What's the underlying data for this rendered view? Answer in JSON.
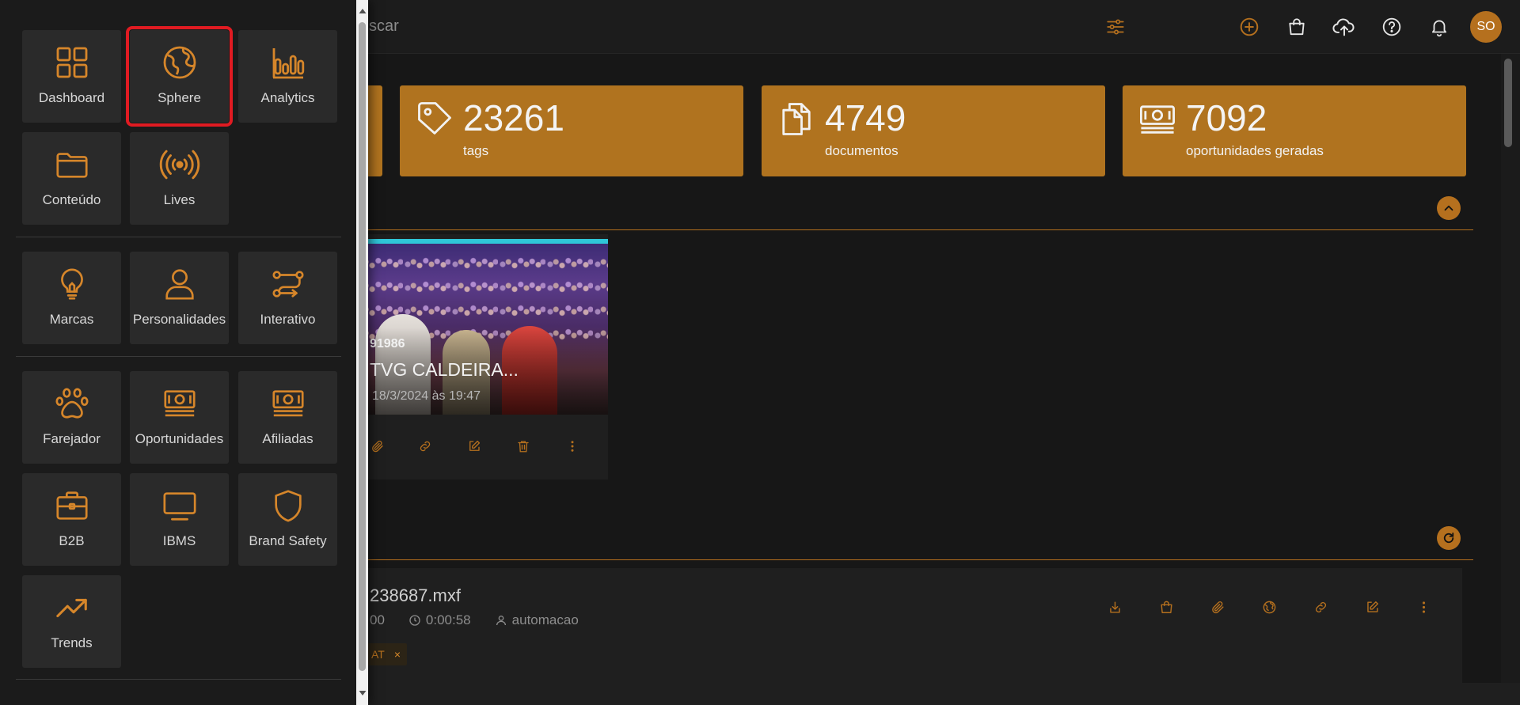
{
  "colors": {
    "accent": "#b5701e",
    "card": "#b0731f",
    "selected_outline": "#e01b22",
    "background": "#171717"
  },
  "header": {
    "search_text": "scar",
    "icons": [
      "filter-sliders-icon",
      "add-circle-icon",
      "shopping-bag-icon",
      "cloud-upload-icon",
      "help-icon",
      "bell-icon"
    ],
    "avatar_initials": "SO"
  },
  "stats": [
    {
      "value": "23261",
      "label": "tags",
      "icon": "tag-icon"
    },
    {
      "value": "4749",
      "label": "documentos",
      "icon": "documents-icon"
    },
    {
      "value": "7092",
      "label": "oportunidades geradas",
      "icon": "money-icon"
    }
  ],
  "media_card": {
    "id": "91986",
    "title": "TVG CALDEIRA...",
    "date": "18/3/2024 às 19:47",
    "actions": [
      "attach-icon",
      "link-icon",
      "edit-icon",
      "trash-icon",
      "more-vertical-icon"
    ]
  },
  "file_row": {
    "name": "238687.mxf",
    "meta_partial": "00",
    "duration": "0:00:58",
    "user": "automacao",
    "tag": "AT",
    "tag_remove": "×",
    "actions": [
      "download-icon",
      "shopping-bag-icon",
      "attach-icon",
      "globe-icon",
      "link-icon",
      "edit-icon",
      "more-vertical-icon"
    ]
  },
  "drawer": {
    "items": [
      {
        "label": "Dashboard",
        "icon": "dashboard-grid-icon",
        "selected": false
      },
      {
        "label": "Sphere",
        "icon": "globe-icon",
        "selected": true
      },
      {
        "label": "Analytics",
        "icon": "bar-chart-icon",
        "selected": false
      },
      {
        "label": "Conteúdo",
        "icon": "folder-icon",
        "selected": false
      },
      {
        "label": "Lives",
        "icon": "broadcast-icon",
        "selected": false
      },
      {
        "label": "Marcas",
        "icon": "lightbulb-icon",
        "selected": false
      },
      {
        "label": "Personalidades",
        "icon": "person-icon",
        "selected": false
      },
      {
        "label": "Interativo",
        "icon": "flow-icon",
        "selected": false
      },
      {
        "label": "Farejador",
        "icon": "paw-icon",
        "selected": false
      },
      {
        "label": "Oportunidades",
        "icon": "money-icon",
        "selected": false
      },
      {
        "label": "Afiliadas",
        "icon": "money-icon",
        "selected": false
      },
      {
        "label": "B2B",
        "icon": "briefcase-icon",
        "selected": false
      },
      {
        "label": "IBMS",
        "icon": "monitor-icon",
        "selected": false
      },
      {
        "label": "Brand Safety",
        "icon": "shield-icon",
        "selected": false
      },
      {
        "label": "Trends",
        "icon": "trending-up-icon",
        "selected": false
      }
    ]
  }
}
